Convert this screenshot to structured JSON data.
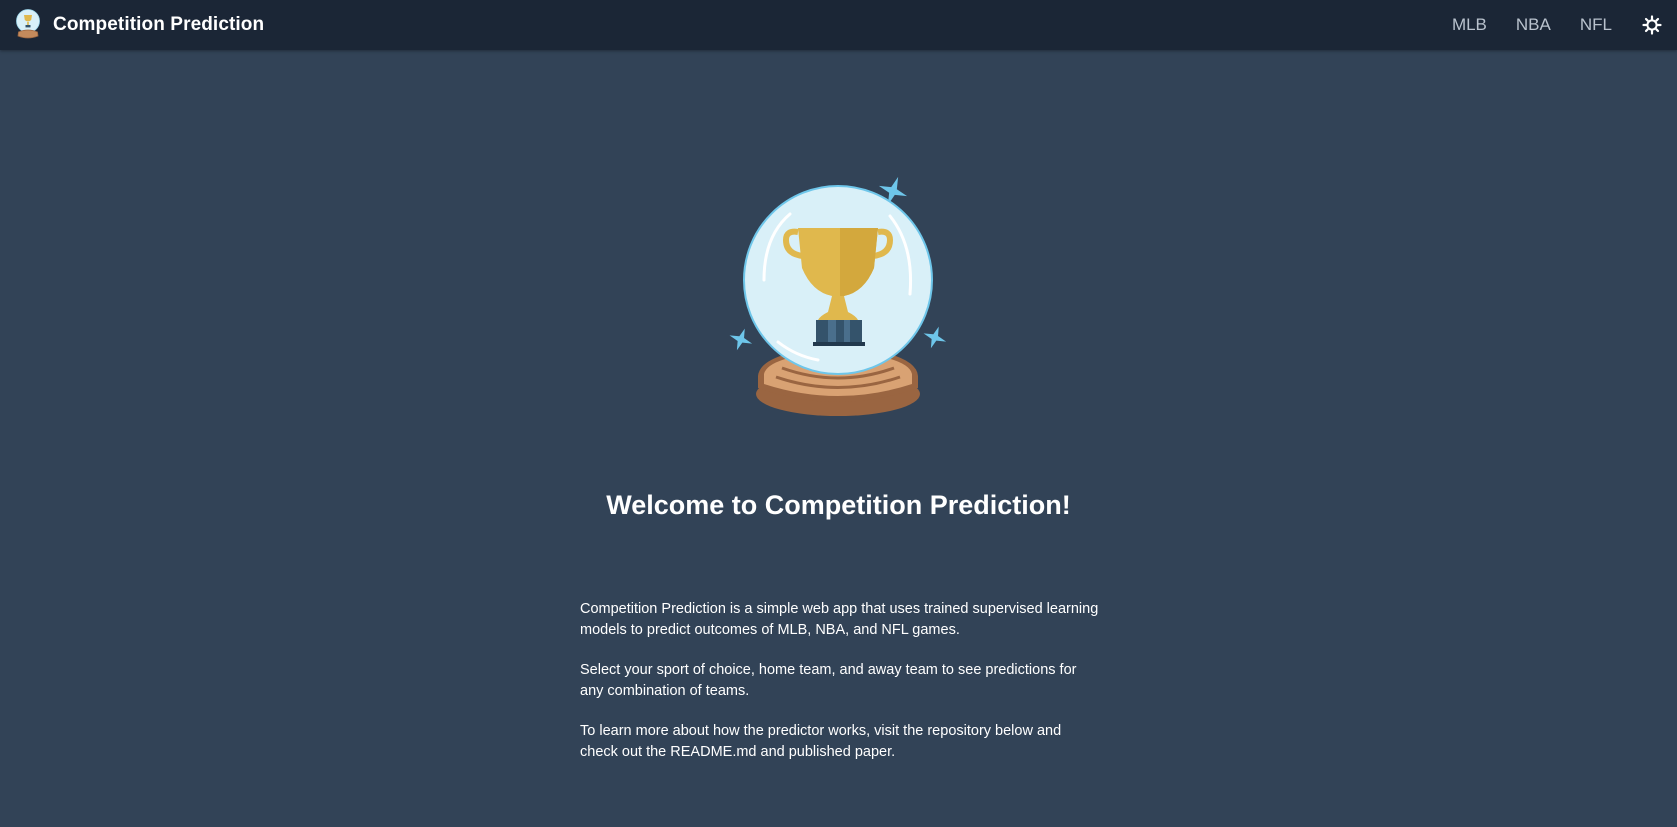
{
  "navbar": {
    "brand_name": "Competition Prediction",
    "logo_icon": "crystal-ball-trophy-icon",
    "links": [
      {
        "label": "MLB"
      },
      {
        "label": "NBA"
      },
      {
        "label": "NFL"
      }
    ],
    "theme_toggle_icon": "sun-icon"
  },
  "main": {
    "hero_icon": "crystal-ball-trophy-icon",
    "heading": "Welcome to Competition Prediction!",
    "paragraphs": [
      "Competition Prediction is a simple web app that uses trained supervised learning models to predict outcomes of MLB, NBA, and NFL games.",
      "Select your sport of choice, home team, and away team to see predictions for any combination of teams.",
      "To learn more about how the predictor works, visit the repository below and check out the README.md and published paper."
    ]
  },
  "colors": {
    "page_background": "#324357",
    "navbar_background": "#1b2636",
    "nav_link": "#b9c2cd",
    "text": "#ffffff",
    "trophy_gold": "#e0b84d",
    "globe_blue": "#d9f0f8",
    "base_brown": "#c48a5c",
    "sparkle": "#6ec6ea"
  }
}
